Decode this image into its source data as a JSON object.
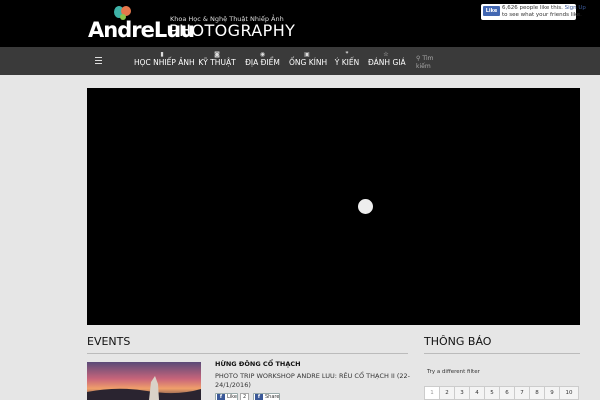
{
  "header": {
    "logo_word": "AndreLuu",
    "tagline": "Khoa Học & Nghệ Thuật Nhiếp Ảnh",
    "photography": "PHOTOGRAPHY",
    "facebook": {
      "like_label": "Like",
      "count_text": "6,626 people like this.",
      "signup_link": "Sign Up",
      "signup_rest": "to see what your friends like."
    }
  },
  "nav": {
    "items": [
      {
        "label": "HỌC NHIẾP ẢNH",
        "icon": "book-icon",
        "glyph": "▮"
      },
      {
        "label": "KỸ THUẬT",
        "icon": "camera-icon",
        "glyph": "◙"
      },
      {
        "label": "ĐỊA ĐIỂM",
        "icon": "location-icon",
        "glyph": "◉"
      },
      {
        "label": "ỐNG KÍNH",
        "icon": "lens-icon",
        "glyph": "▣"
      },
      {
        "label": "Ý KIẾN",
        "icon": "quote-icon",
        "glyph": "❞"
      },
      {
        "label": "ĐÁNH GIÁ",
        "icon": "star-icon",
        "glyph": "☆"
      }
    ],
    "search_label": "Tìm kiếm",
    "search_glyph": "⚲"
  },
  "events": {
    "title": "EVENTS",
    "item": {
      "title": "HỪNG ĐÔNG CỔ THẠCH",
      "subtitle": "PHOTO TRIP WORKSHOP ANDRE LUU: RÊU CỔ THẠCH II (22-24/1/2016)",
      "like_label": "Like",
      "like_count": "2",
      "share_label": "Share",
      "fb_glyph": "f"
    }
  },
  "sidebar": {
    "title": "THÔNG BÁO",
    "filter_text": "Try a different filter",
    "pages": [
      "1",
      "2",
      "3",
      "4",
      "5",
      "6",
      "7",
      "8",
      "9",
      "10"
    ]
  },
  "colors": {
    "header_bg": "#000000",
    "nav_bg": "#3a3a3a",
    "page_bg": "#e6e6e6",
    "fb_blue": "#3b5998"
  }
}
